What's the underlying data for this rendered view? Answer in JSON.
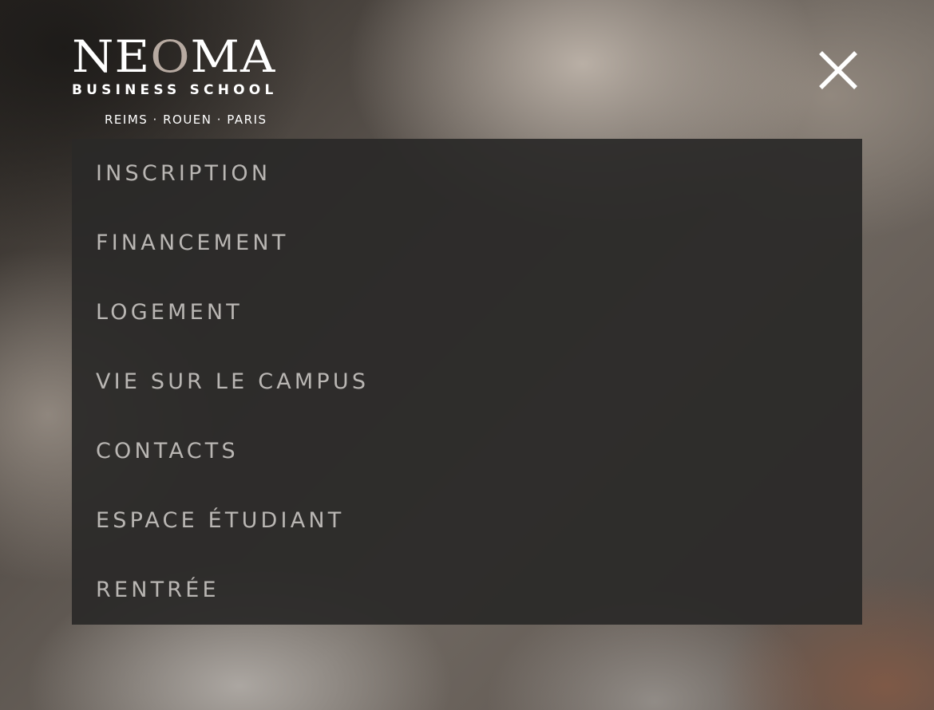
{
  "logo": {
    "word_left": "NE",
    "word_o": "O",
    "word_right": "MA",
    "tagline": "BUSINESS SCHOOL",
    "campuses": "REIMS · ROUEN · PARIS"
  },
  "close_button": {
    "icon": "close-icon",
    "color": "#ffffff"
  },
  "menu": {
    "items": [
      {
        "label": "INSCRIPTION"
      },
      {
        "label": "FINANCEMENT"
      },
      {
        "label": "LOGEMENT"
      },
      {
        "label": "VIE SUR LE CAMPUS"
      },
      {
        "label": "CONTACTS"
      },
      {
        "label": "ESPACE ÉTUDIANT"
      },
      {
        "label": "RENTRÉE"
      }
    ]
  },
  "colors": {
    "menu_text": "#b9b6b3",
    "panel_background": "#2a2928"
  }
}
